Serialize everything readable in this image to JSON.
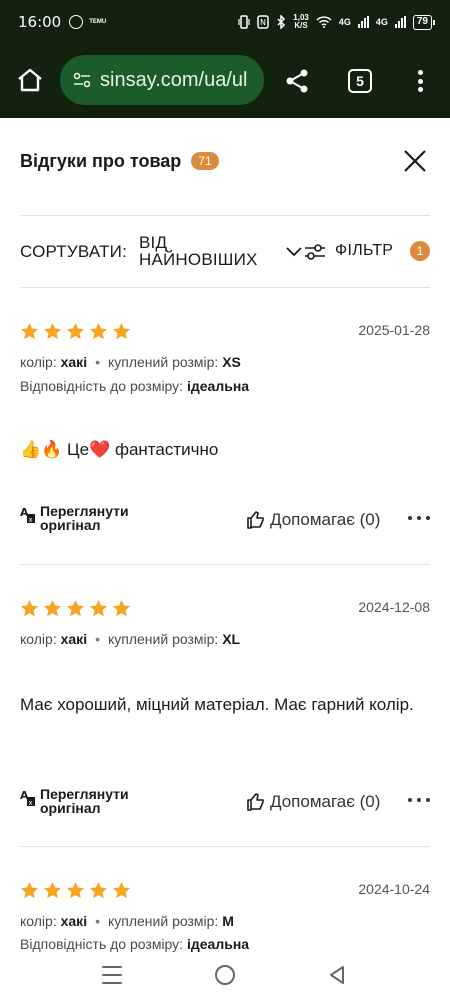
{
  "status_bar": {
    "time": "16:00",
    "net_speed_value": "1,03",
    "net_speed_unit": "K/S",
    "net_type_1": "4G",
    "net_type_2": "4G",
    "battery": "79",
    "temu_label": "TEMU"
  },
  "browser": {
    "url": "sinsay.com/ua/ul",
    "tab_count": "5"
  },
  "header": {
    "title": "Відгуки про товар",
    "count": "71"
  },
  "sort": {
    "label": "СОРТУВАТИ:",
    "value": "ВІД НАЙНОВІШИХ",
    "filter_label": "ФІЛЬТР",
    "filter_count": "1"
  },
  "colors": {
    "star": "#f5a524",
    "badge": "#dc8a3e",
    "browser_bg": "#12220f",
    "url_pill": "#1c5b2c"
  },
  "reviews": [
    {
      "rating": 5,
      "date": "2025-01-28",
      "color_label": "колір:",
      "color_value": "хакі",
      "size_label": "куплений розмір:",
      "size_value": "XS",
      "fit_label": "Відповідність до розміру:",
      "fit_value": "ідеальна",
      "text": "👍🔥 Це❤️ фантастично",
      "translate_label": "Переглянути оригінал",
      "helpful_label": "Допомагає (0)"
    },
    {
      "rating": 5,
      "date": "2024-12-08",
      "color_label": "колір:",
      "color_value": "хакі",
      "size_label": "куплений розмір:",
      "size_value": "XL",
      "text": "Має хороший, міцний матеріал. Має гарний колір.",
      "translate_label": "Переглянути оригінал",
      "helpful_label": "Допомагає (0)"
    },
    {
      "rating": 5,
      "date": "2024-10-24",
      "color_label": "колір:",
      "color_value": "хакі",
      "size_label": "куплений розмір:",
      "size_value": "M",
      "fit_label": "Відповідність до розміру:",
      "fit_value": "ідеальна"
    }
  ]
}
